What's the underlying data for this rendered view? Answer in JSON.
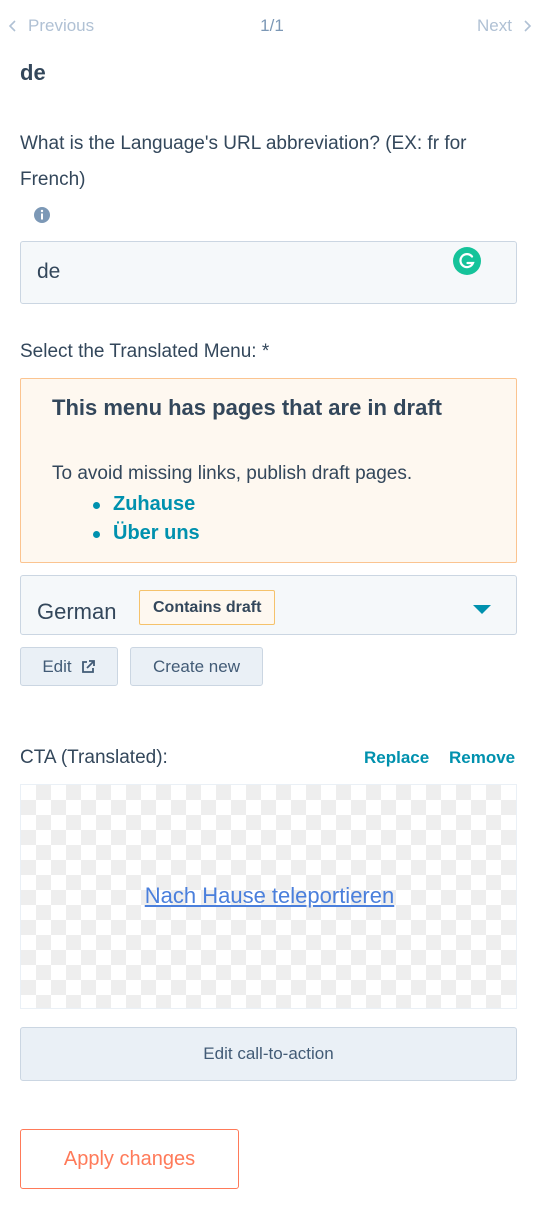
{
  "pager": {
    "prev_label": "Previous",
    "count": "1/1",
    "next_label": "Next"
  },
  "language_heading": "de",
  "url_field": {
    "label": "What is the Language's URL abbreviation? (EX: fr for French)",
    "value": "de"
  },
  "menu": {
    "label": "Select the Translated Menu: *",
    "alert": {
      "title": "This menu has pages that are in draft",
      "body": "To avoid missing links, publish draft pages.",
      "pages": [
        "Zuhause",
        "Über uns"
      ]
    },
    "selected": "German",
    "badge": "Contains draft",
    "edit_label": "Edit",
    "create_label": "Create new"
  },
  "cta": {
    "label": "CTA (Translated):",
    "replace_label": "Replace",
    "remove_label": "Remove",
    "preview_text": "Nach Hause teleportieren",
    "edit_button": "Edit call-to-action"
  },
  "apply_label": "Apply changes",
  "colors": {
    "accent": "#0091ae",
    "primary_action": "#ff7a59",
    "text": "#33475b",
    "warning_bg": "#fef8f0",
    "warning_border": "#fbc490"
  }
}
